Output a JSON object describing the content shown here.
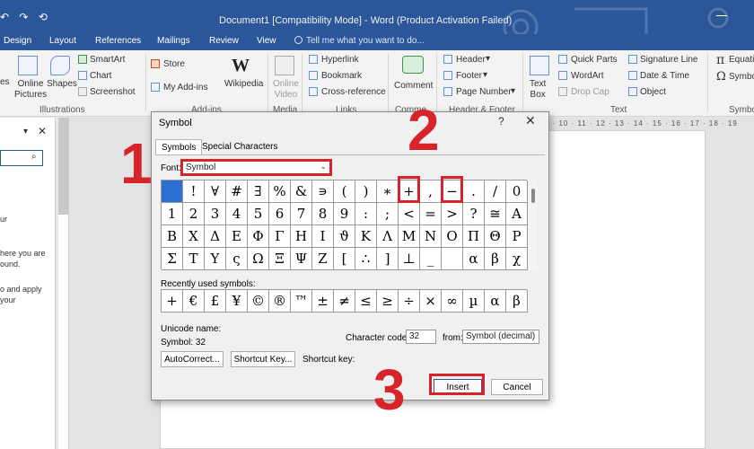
{
  "titlebar": {
    "qat": "↶ ↷ ⟲",
    "title": "Document1 [Compatibility Mode] - Word (Product Activation Failed)"
  },
  "tabs": [
    "Design",
    "Layout",
    "References",
    "Mailings",
    "Review",
    "View"
  ],
  "tell_me": "Tell me what you want to do...",
  "ribbon": {
    "pictures": "Online\nPictures",
    "shapes": "Shapes",
    "smartart": "SmartArt",
    "chart": "Chart",
    "screenshot": "Screenshot",
    "store": "Store",
    "my_addins": "My Add-ins",
    "wikipedia": "Wikipedia",
    "wiki_letter": "W",
    "online_video": "Online\nVideo",
    "hyperlink": "Hyperlink",
    "bookmark": "Bookmark",
    "crossref": "Cross-reference",
    "comment": "Comment",
    "header": "Header",
    "footer": "Footer",
    "page_number": "Page Number",
    "text_box": "Text\nBox",
    "quick_parts": "Quick Parts",
    "wordart": "WordArt",
    "drop_cap": "Drop Cap",
    "signature_line": "Signature Line",
    "date_time": "Date & Time",
    "object": "Object",
    "equation": "Equatio",
    "symbol_btn": "Symbo",
    "groups": {
      "illustrations": "Illustrations",
      "addins": "Add-ins",
      "media": "Media",
      "links": "Links",
      "comments": "Comme",
      "header_footer": "Header & Footer",
      "text": "Text",
      "symbols": "Symbo"
    }
  },
  "navpane": {
    "lines": [
      "ur",
      "here you are",
      "ound.",
      "o and apply",
      "your"
    ]
  },
  "ruler_text": "· 9 · 10 · 11 · 12 · 13 · 14 · 15 · 16 · 17 · 18 · 19",
  "dialog": {
    "title": "Symbol",
    "help": "?",
    "close": "✕",
    "tab_symbols": "Symbols",
    "tab_special": "Special Characters",
    "font_label": "Font:",
    "font_value": "Symbol",
    "symbol_grid": [
      " ",
      "!",
      "∀",
      "#",
      "∃",
      "%",
      "&",
      "∍",
      "(",
      ")",
      "∗",
      "+",
      ",",
      "−",
      ".",
      "/",
      "0",
      "1",
      "2",
      "3",
      "4",
      "5",
      "6",
      "7",
      "8",
      "9",
      ":",
      ";",
      "<",
      "=",
      ">",
      "?",
      "≅",
      "Α",
      "Β",
      "Χ",
      "Δ",
      "Ε",
      "Φ",
      "Γ",
      "Η",
      "Ι",
      "ϑ",
      "Κ",
      "Λ",
      "Μ",
      "Ν",
      "Ο",
      "Π",
      "Θ",
      "Ρ",
      "Σ",
      "Τ",
      "Υ",
      "ς",
      "Ω",
      "Ξ",
      "Ψ",
      "Ζ",
      "[",
      "∴",
      "]",
      "⊥",
      "_",
      "",
      "α",
      "β",
      "χ"
    ],
    "recent_label": "Recently used symbols:",
    "recent_symbols": [
      "+",
      "€",
      "£",
      "¥",
      "©",
      "®",
      "™",
      "±",
      "≠",
      "≤",
      "≥",
      "÷",
      "×",
      "∞",
      "µ",
      "α",
      "β"
    ],
    "unicode_name_label": "Unicode name:",
    "unicode_value": "Symbol: 32",
    "char_code_label": "Character code:",
    "char_code_value": "32",
    "from_label": "from:",
    "from_value": "Symbol (decimal)",
    "autocorrect_btn": "AutoCorrect...",
    "shortcut_btn": "Shortcut Key...",
    "shortcut_label": "Shortcut key:",
    "insert_btn": "Insert",
    "cancel_btn": "Cancel"
  },
  "annotations": [
    "1",
    "2",
    "3"
  ],
  "colors": {
    "title_blue": "#2b579a",
    "highlight_red": "#d7232a",
    "selected_cell": "#2a6fd1"
  }
}
